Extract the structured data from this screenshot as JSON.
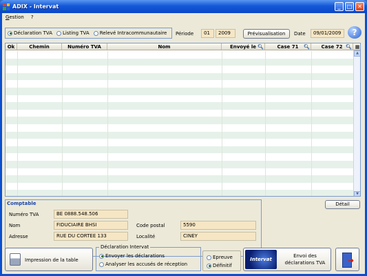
{
  "window": {
    "title": "ADIX - Intervat"
  },
  "menu": {
    "items": [
      "Gestion",
      "?"
    ]
  },
  "options": [
    {
      "label": "Déclaration TVA",
      "checked": true
    },
    {
      "label": "Listing TVA",
      "checked": false
    },
    {
      "label": "Relevé Intracommunautaire",
      "checked": false
    }
  ],
  "periode": {
    "label": "Période",
    "month": "01",
    "year": "2009"
  },
  "preview_label": "Prévisualisation",
  "date": {
    "label": "Date",
    "value": "09/01/2009"
  },
  "table": {
    "columns": [
      "Ok",
      "Chemin",
      "Numéro TVA",
      "Nom",
      "Envoyé le",
      "Case 71",
      "Case 72"
    ],
    "row_count": 20
  },
  "detail_label": "Détail",
  "comptable": {
    "legend": "Comptable",
    "numero_tva_label": "Numéro TVA",
    "numero_tva": "BE 0888.548.506",
    "nom_label": "Nom",
    "nom": "FIDUCIAIRE BHSI",
    "adresse_label": "Adresse",
    "adresse": "RUE DU CORTEE 133",
    "code_postal_label": "Code postal",
    "code_postal": "5590",
    "localite_label": "Localité",
    "localite": "CINEY"
  },
  "print_label": "Impression de la table",
  "declaration": {
    "legend": "Déclaration Intervat",
    "options": [
      {
        "label": "Envoyer les déclarations",
        "checked": true
      },
      {
        "label": "Analyser les accusés de réception",
        "checked": false
      }
    ]
  },
  "mode": [
    {
      "label": "Epreuve",
      "checked": false
    },
    {
      "label": "Définitif",
      "checked": true
    }
  ],
  "intervat_logo": "Intervat",
  "send_label_1": "Envoi des",
  "send_label_2": "déclarations TVA",
  "colors": {
    "title_bar": "#0a46c8",
    "field_bg": "#f6e6c4",
    "row_alt": "#e6f1ea",
    "frame": "#7b9bd0"
  }
}
